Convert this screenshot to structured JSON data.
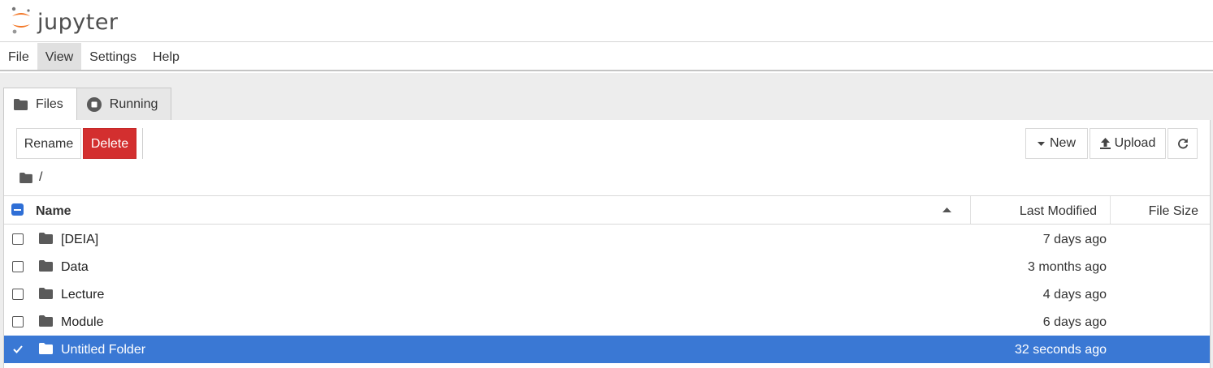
{
  "app": {
    "logo_text": "jupyter"
  },
  "menu": [
    "File",
    "View",
    "Settings",
    "Help"
  ],
  "tabs": [
    {
      "label": "Files"
    },
    {
      "label": "Running"
    }
  ],
  "toolbar": {
    "rename": "Rename",
    "delete": "Delete",
    "new": "New",
    "upload": "Upload"
  },
  "breadcrumb": {
    "path": "/"
  },
  "columns": {
    "name": "Name",
    "modified": "Last Modified",
    "size": "File Size"
  },
  "files": [
    {
      "name": "[DEIA]",
      "modified": "7 days ago",
      "checked": false
    },
    {
      "name": "Data",
      "modified": "3 months ago",
      "checked": false
    },
    {
      "name": "Lecture",
      "modified": "4 days ago",
      "checked": false
    },
    {
      "name": "Module",
      "modified": "6 days ago",
      "checked": false
    },
    {
      "name": "Untitled Folder",
      "modified": "32 seconds ago",
      "checked": true
    }
  ],
  "colors": {
    "selection": "#3a78d4",
    "danger": "#d32f2f",
    "logo_orange": "#f37726"
  }
}
